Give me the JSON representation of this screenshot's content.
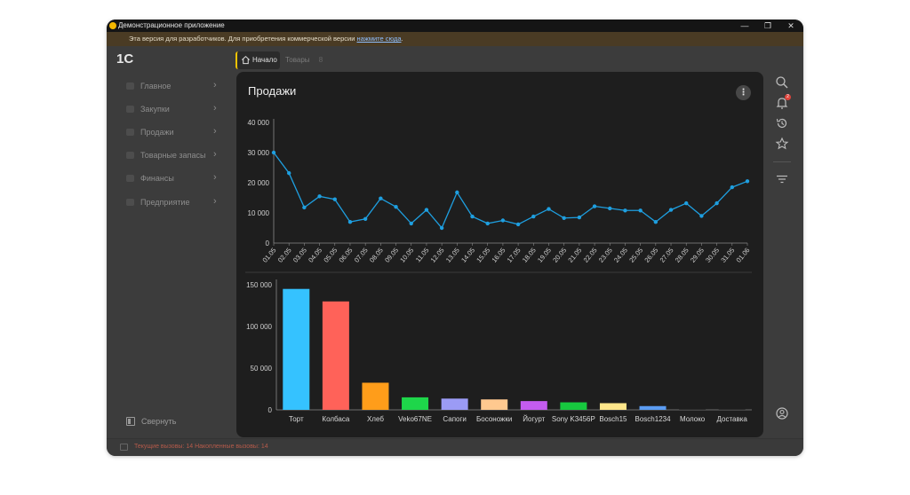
{
  "window": {
    "title": "Демонстрационное приложение",
    "controls": {
      "minimize": "—",
      "restore": "❐",
      "close": "✕"
    }
  },
  "dev_notice": {
    "text": "Эта версия для разработчиков. Для приобретения коммерческой версии ",
    "link": "нажмите сюда",
    "suffix": "."
  },
  "logo": {
    "text": "1С"
  },
  "tabs": [
    {
      "label": "Начало",
      "active": true
    },
    {
      "label": "Товары",
      "count": "8"
    }
  ],
  "sidebar": {
    "items": [
      {
        "label": "Главное"
      },
      {
        "label": "Закупки"
      },
      {
        "label": "Продажи"
      },
      {
        "label": "Товарные запасы"
      },
      {
        "label": "Финансы"
      },
      {
        "label": "Предприятие"
      }
    ],
    "collapse_label": "Свернуть"
  },
  "status": {
    "text": "Текущие вызовы: 14   Накопленные вызовы: 14"
  },
  "panel": {
    "title": "Продажи",
    "menu_icon": "more-vertical-icon"
  },
  "right_toolbar": {
    "icons": [
      "search-icon",
      "bell-icon",
      "history-icon",
      "star-icon",
      "filter-icon",
      "user-icon"
    ],
    "notification_count": "2"
  },
  "colors": {
    "line": "#1e9fe0",
    "accent_tab": "#f5c400",
    "panel_bg": "#1e1e1e",
    "window_bg": "#3c3c3c"
  },
  "chart_data": [
    {
      "type": "line",
      "x": [
        "01.05",
        "02.05",
        "03.05",
        "04.05",
        "05.05",
        "06.05",
        "07.05",
        "08.05",
        "09.05",
        "10.05",
        "11.05",
        "12.05",
        "13.05",
        "14.05",
        "15.05",
        "16.05",
        "17.05",
        "18.05",
        "19.05",
        "20.05",
        "21.05",
        "22.05",
        "23.05",
        "24.05",
        "25.05",
        "26.05",
        "27.05",
        "28.05",
        "29.05",
        "30.05",
        "31.05",
        "01.06"
      ],
      "values": [
        30000,
        23200,
        11800,
        15500,
        14500,
        7000,
        8000,
        14800,
        12000,
        6500,
        11000,
        5000,
        16800,
        8800,
        6500,
        7500,
        6200,
        8800,
        11300,
        8300,
        8500,
        12200,
        11500,
        10800,
        10800,
        7000,
        11000,
        13200,
        9000,
        13200,
        18500,
        20500
      ],
      "yticks": [
        "40 000",
        "30 000",
        "20 000",
        "10 000",
        "0"
      ],
      "ytick_values": [
        40000,
        30000,
        20000,
        10000,
        0
      ],
      "ylim": [
        0,
        40000
      ],
      "grid": false
    },
    {
      "type": "bar",
      "categories": [
        "Торт",
        "Колбаса",
        "Хлеб",
        "Veko67NE",
        "Сапоги",
        "Босоножки",
        "Йогурт",
        "Sony K3456P",
        "Bosch15",
        "Bosch1234",
        "Молоко",
        "Доставка"
      ],
      "values": [
        145000,
        130000,
        32500,
        15000,
        13500,
        12500,
        10500,
        9000,
        8000,
        4500,
        0,
        0
      ],
      "colors": [
        "#35c2ff",
        "#ff6259",
        "#ff9d1a",
        "#1ed64a",
        "#9b9bf5",
        "#ffc98f",
        "#c45cf0",
        "#17c93f",
        "#ffe68a",
        "#5b9cf2",
        "#2b2b2b",
        "#2b2b2b"
      ],
      "yticks": [
        "150 000",
        "100 000",
        "50 000",
        "0"
      ],
      "ytick_values": [
        150000,
        100000,
        50000,
        0
      ],
      "ylim": [
        0,
        150000
      ],
      "grid": false
    }
  ]
}
